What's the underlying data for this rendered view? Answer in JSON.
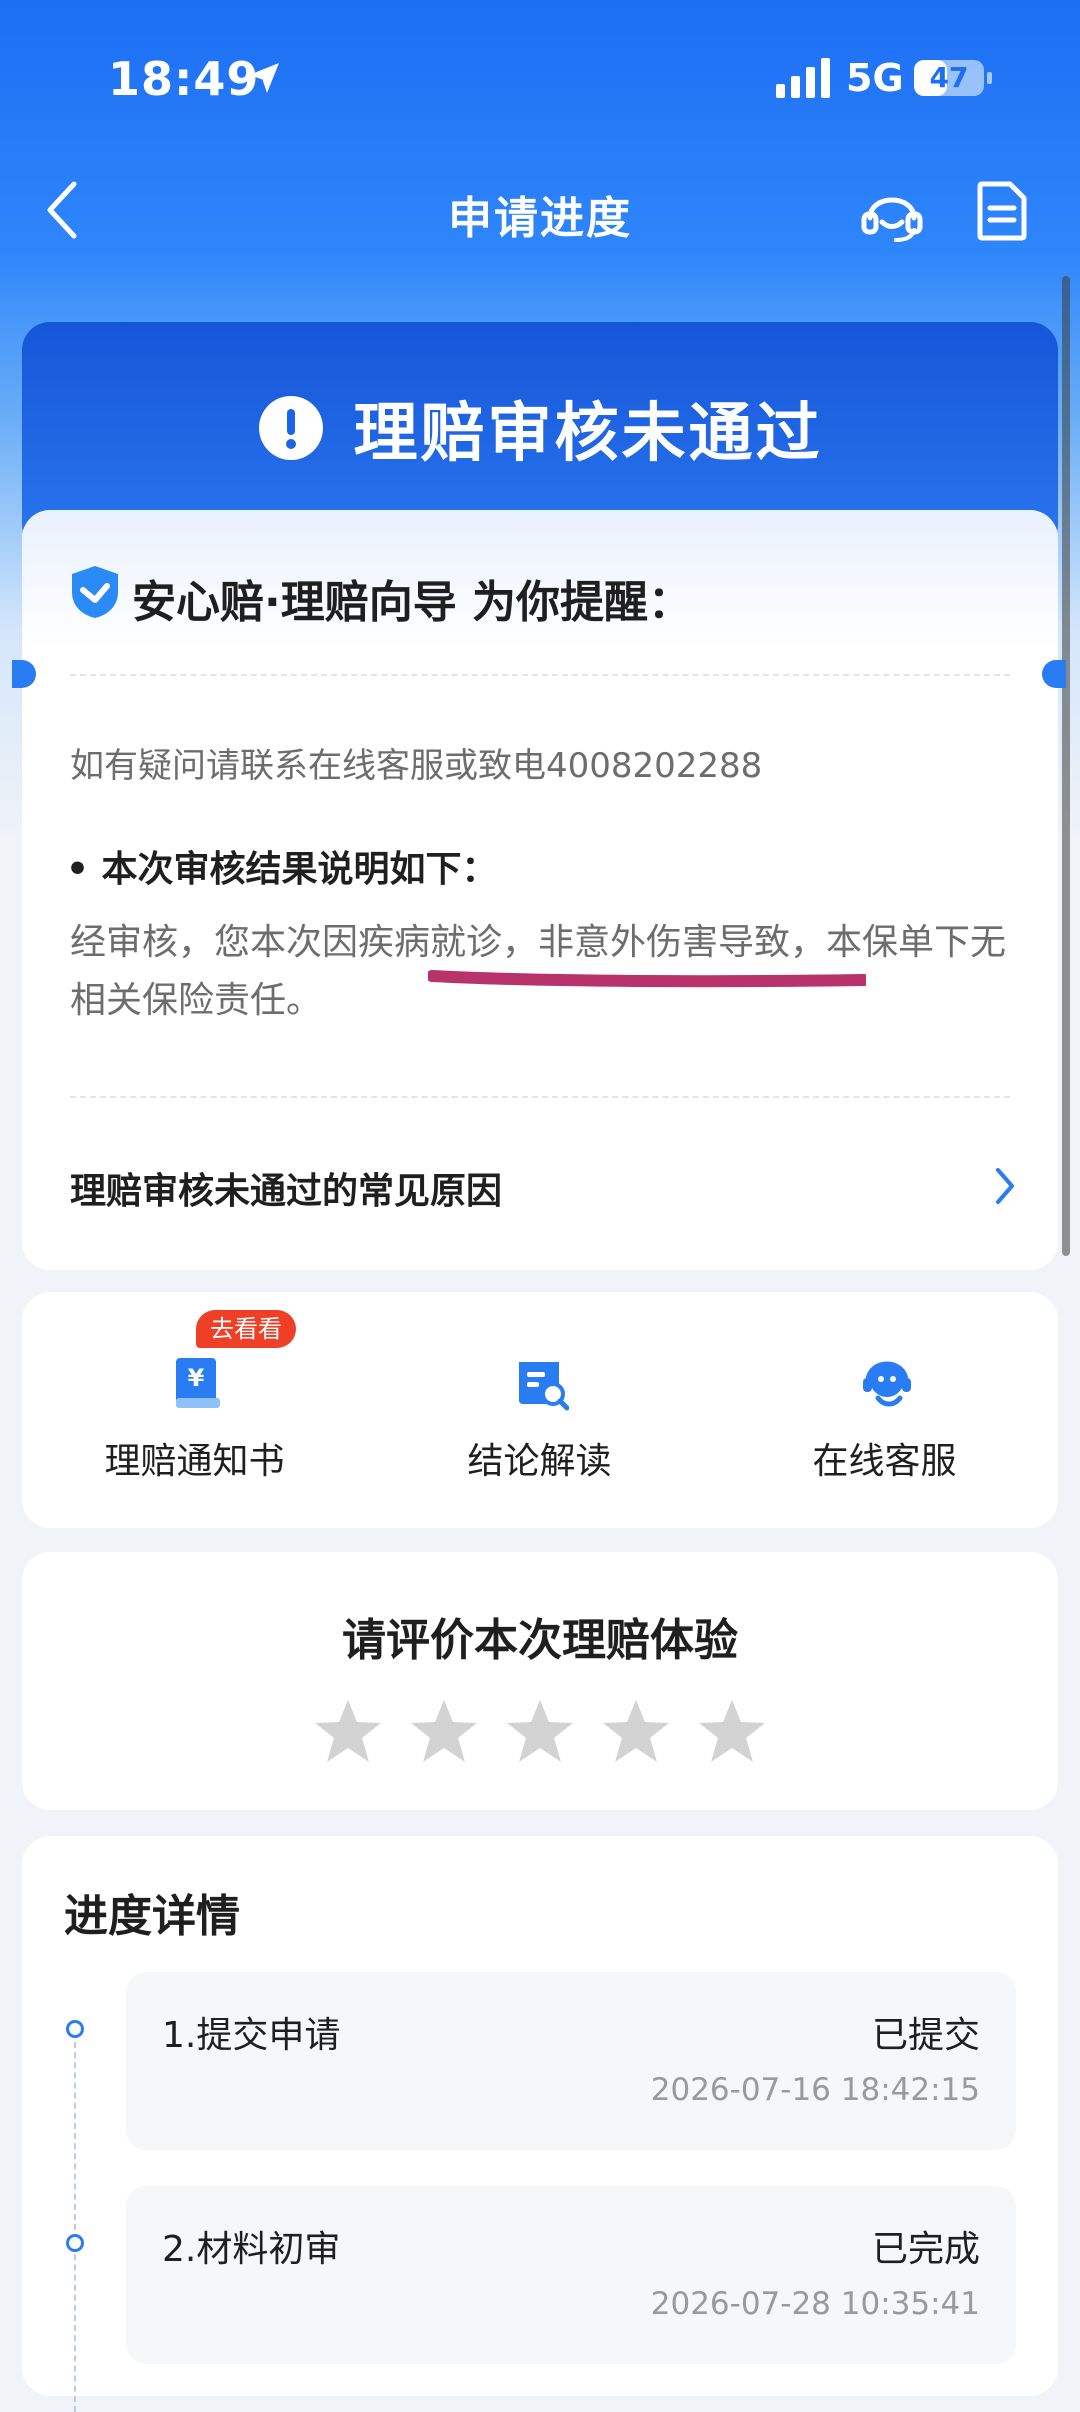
{
  "status_bar": {
    "time": "18:49",
    "network": "5G",
    "battery": 47
  },
  "nav": {
    "title": "申请进度",
    "icons": [
      "back-icon",
      "customer-service-icon",
      "document-icon"
    ]
  },
  "result": {
    "title": "理赔审核未通过",
    "icon": "exclamation-icon"
  },
  "guide": {
    "brand": "安心赔·理赔向导 为你提醒：",
    "contact": "如有疑问请联系在线客服或致电4008202288",
    "section_title": "• 本次审核结果说明如下：",
    "description": "经审核，您本次因疾病就诊，非意外伤害导致，本保单下无相关保险责任。",
    "faq_link": "理赔审核未通过的常见原因"
  },
  "actions": [
    {
      "label": "理赔通知书",
      "badge": "去看看",
      "icon": "notice-book-icon"
    },
    {
      "label": "结论解读",
      "icon": "conclusion-search-icon"
    },
    {
      "label": "在线客服",
      "icon": "headset-icon"
    }
  ],
  "rating": {
    "title": "请评价本次理赔体验",
    "stars_total": 5,
    "stars_selected": 0
  },
  "progress": {
    "title": "进度详情",
    "steps": [
      {
        "name": "1.提交申请",
        "status": "已提交",
        "time": "2026-07-16 18:42:15"
      },
      {
        "name": "2.材料初审",
        "status": "已完成",
        "time": "2026-07-28 10:35:41"
      }
    ]
  },
  "colors": {
    "primary": "#1c6ef3",
    "badge": "#ef3f26",
    "highlight_underline": "#b8336a"
  }
}
